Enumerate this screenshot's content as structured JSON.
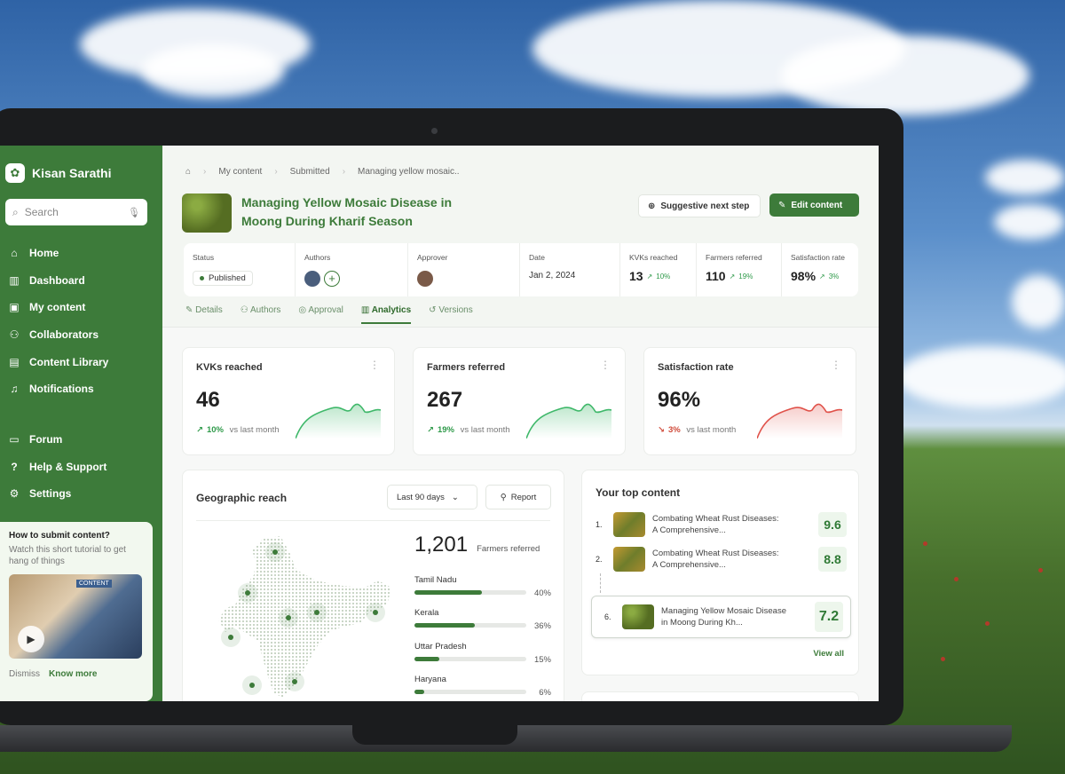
{
  "app": {
    "name": "Kisan Sarathi"
  },
  "search": {
    "placeholder": "Search"
  },
  "nav": [
    "Home",
    "Dashboard",
    "My content",
    "Collaborators",
    "Content Library",
    "Notifications"
  ],
  "nav_bottom": [
    "Forum",
    "Help & Support",
    "Settings"
  ],
  "tutorial": {
    "title": "How to submit content?",
    "desc": "Watch this short tutorial to get hang of things",
    "thumb_tag": "CONTENT",
    "dismiss": "Dismiss",
    "know_more": "Know more"
  },
  "breadcrumb": [
    "My content",
    "Submitted",
    "Managing yellow mosaic.."
  ],
  "page": {
    "title": "Managing Yellow Mosaic Disease in Moong During Kharif Season",
    "next_step": "Suggestive next step",
    "edit": "Edit content"
  },
  "meta": {
    "status_label": "Status",
    "status": "Published",
    "authors_label": "Authors",
    "approver_label": "Approver",
    "date_label": "Date",
    "date": "Jan 2, 2024",
    "kvks_label": "KVKs reached",
    "kvks": "13",
    "kvks_delta": "10%",
    "farmers_label": "Farmers referred",
    "farmers": "110",
    "farmers_delta": "19%",
    "sat_label": "Satisfaction rate",
    "sat": "98%",
    "sat_delta": "3%"
  },
  "tabs": [
    "Details",
    "Authors",
    "Approval",
    "Analytics",
    "Versions"
  ],
  "kpis": [
    {
      "title": "KVKs reached",
      "value": "46",
      "delta": "10%",
      "note": "vs last month",
      "trend": "up"
    },
    {
      "title": "Farmers referred",
      "value": "267",
      "delta": "19%",
      "note": "vs last month",
      "trend": "up"
    },
    {
      "title": "Satisfaction rate",
      "value": "96%",
      "delta": "3%",
      "note": "vs last month",
      "trend": "down"
    }
  ],
  "geo": {
    "title": "Geographic reach",
    "range": "Last 90 days",
    "report": "Report",
    "total": "1,201",
    "total_label": "Farmers referred",
    "states": [
      {
        "name": "Tamil Nadu",
        "pct": "40%",
        "value": 40
      },
      {
        "name": "Kerala",
        "pct": "36%",
        "value": 36
      },
      {
        "name": "Uttar Pradesh",
        "pct": "15%",
        "value": 15
      },
      {
        "name": "Haryana",
        "pct": "6%",
        "value": 6
      }
    ]
  },
  "top_content": {
    "title": "Your top content",
    "items": [
      {
        "rank": "1.",
        "text": "Combating Wheat Rust Diseases: A Comprehensive...",
        "score": "9.6"
      },
      {
        "rank": "2.",
        "text": "Combating Wheat Rust Diseases: A Comprehensive...",
        "score": "8.8"
      },
      {
        "rank": "6.",
        "text": "Managing Yellow Mosaic Disease in Moong During Kh...",
        "score": "7.2"
      }
    ],
    "view_all": "View all"
  },
  "colors": {
    "brand": "#3d7b3a",
    "positive": "#2f9a4a",
    "negative": "#d04a3a"
  }
}
